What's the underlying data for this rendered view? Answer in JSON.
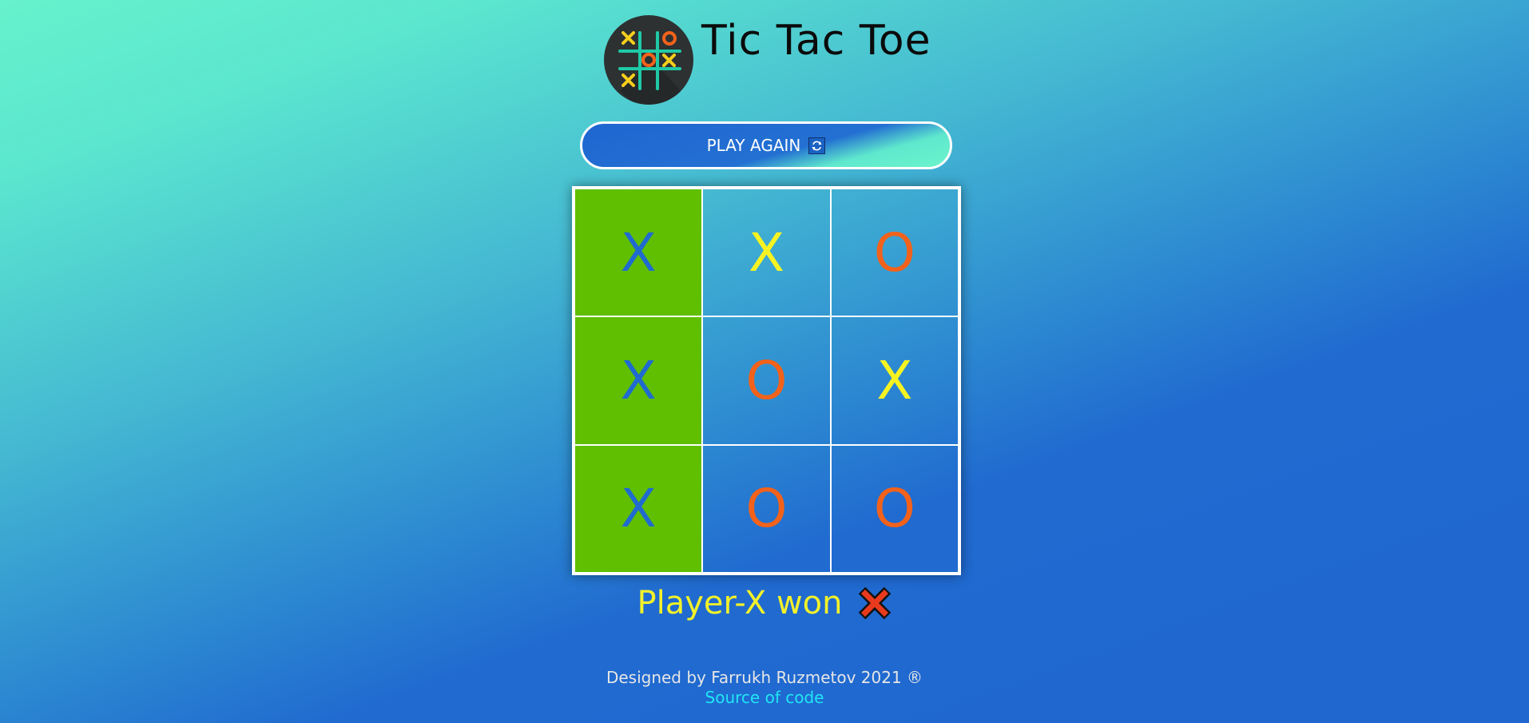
{
  "header": {
    "title": "Tic Tac Toe",
    "logo_icon": "tic-tac-toe-logo"
  },
  "controls": {
    "play_again_label": "PLAY AGAIN",
    "play_again_icon": "refresh-icon"
  },
  "board": {
    "cells": [
      {
        "mark": "X",
        "color": "#1f6bd0",
        "winning": true
      },
      {
        "mark": "X",
        "color": "#f7f322",
        "winning": false
      },
      {
        "mark": "O",
        "color": "#f2621b",
        "winning": false
      },
      {
        "mark": "X",
        "color": "#1f6bd0",
        "winning": true
      },
      {
        "mark": "O",
        "color": "#f2621b",
        "winning": false
      },
      {
        "mark": "X",
        "color": "#f7f322",
        "winning": false
      },
      {
        "mark": "X",
        "color": "#1f6bd0",
        "winning": true
      },
      {
        "mark": "O",
        "color": "#f2621b",
        "winning": false
      },
      {
        "mark": "O",
        "color": "#f2621b",
        "winning": false
      }
    ],
    "win_color": "#60bf00"
  },
  "status": {
    "text": "Player-X won",
    "icon": "cross-mark-icon"
  },
  "footer": {
    "credit": "Designed by Farrukh Ruzmetov 2021 ®",
    "source_link": "Source of code"
  }
}
